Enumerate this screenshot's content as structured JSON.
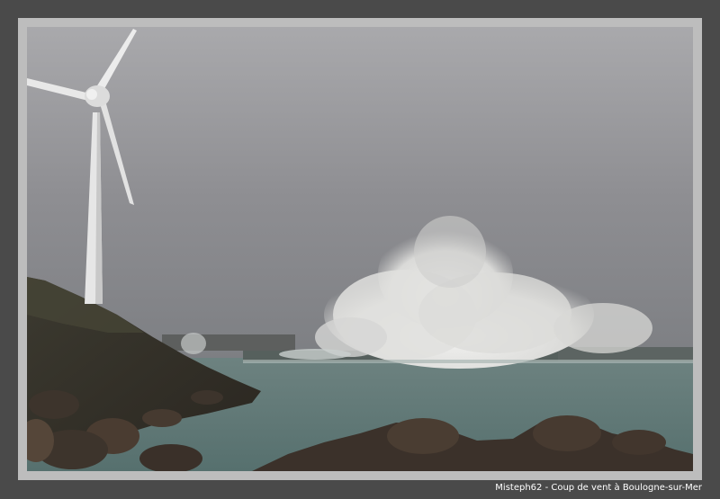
{
  "photo": {
    "subject": "wind-turbine-storm-wave-harbour",
    "colors": {
      "border": "#4a4a4a",
      "mat": "#bdbdbd",
      "sky": "#8c8c90",
      "sea": "#5f7674",
      "spray": "#e4e4e2",
      "rocks": "#3a3028"
    }
  },
  "caption": {
    "text": "Misteph62 - Coup de vent à Boulogne-sur-Mer"
  }
}
